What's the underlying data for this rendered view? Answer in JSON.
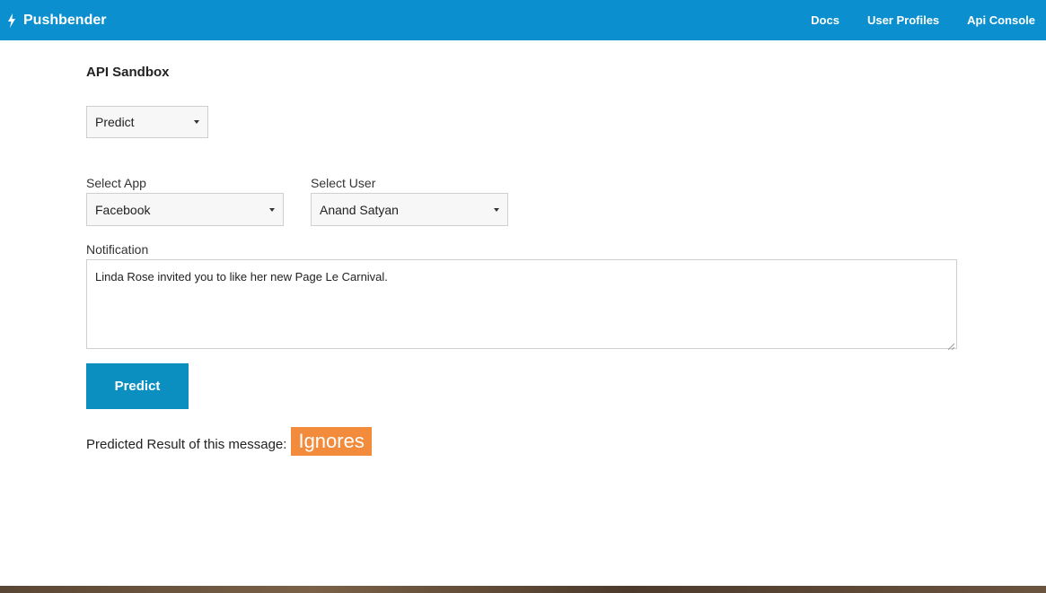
{
  "navbar": {
    "brand": "Pushbender",
    "links": [
      "Docs",
      "User Profiles",
      "Api Console"
    ]
  },
  "page": {
    "title": "API Sandbox"
  },
  "endpoint_select": {
    "value": "Predict"
  },
  "app_select": {
    "label": "Select App",
    "value": "Facebook"
  },
  "user_select": {
    "label": "Select User",
    "value": "Anand Satyan"
  },
  "notification": {
    "label": "Notification",
    "value": "Linda Rose invited you to like her new Page Le Carnival."
  },
  "predict_button": {
    "label": "Predict"
  },
  "result": {
    "text": "Predicted Result of this message:",
    "value": "Ignores"
  },
  "colors": {
    "navbar": "#0b8fce",
    "button": "#0b8fc0",
    "badge": "#f28b3c"
  }
}
